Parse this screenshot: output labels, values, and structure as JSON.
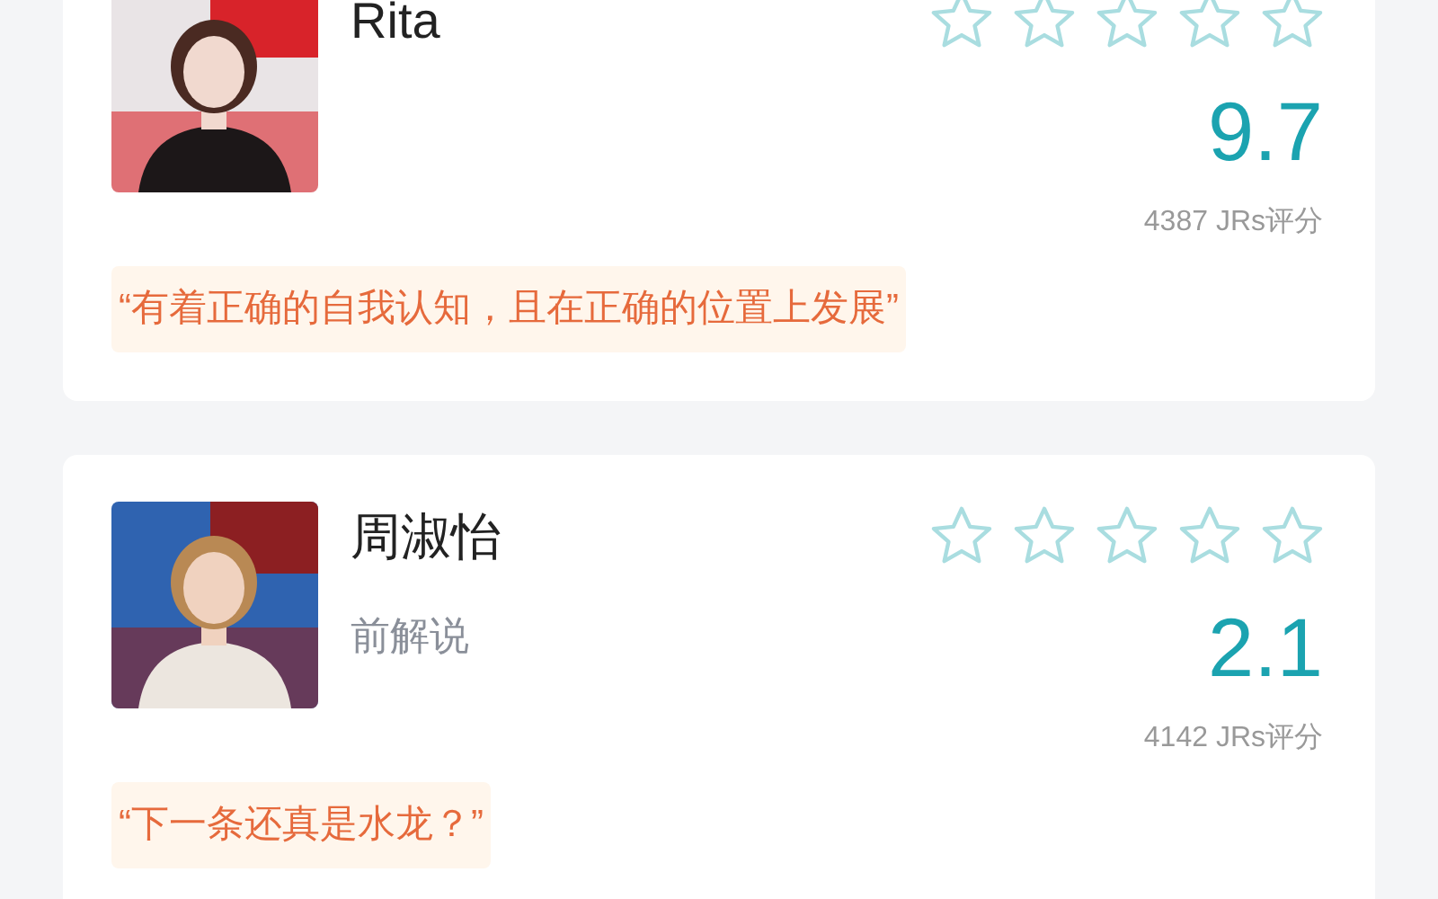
{
  "cards": [
    {
      "name": "Rita",
      "stars": 0,
      "score": "9.7",
      "count": "4387 JRs评分",
      "quote": "“有着正确的自我认知，且在正确的位置上发展”"
    },
    {
      "name": "周淑怡",
      "subtitle": "前解说",
      "stars": 0,
      "score": "2.1",
      "count": "4142 JRs评分",
      "quote": "“下一条还真是水龙？”"
    }
  ]
}
